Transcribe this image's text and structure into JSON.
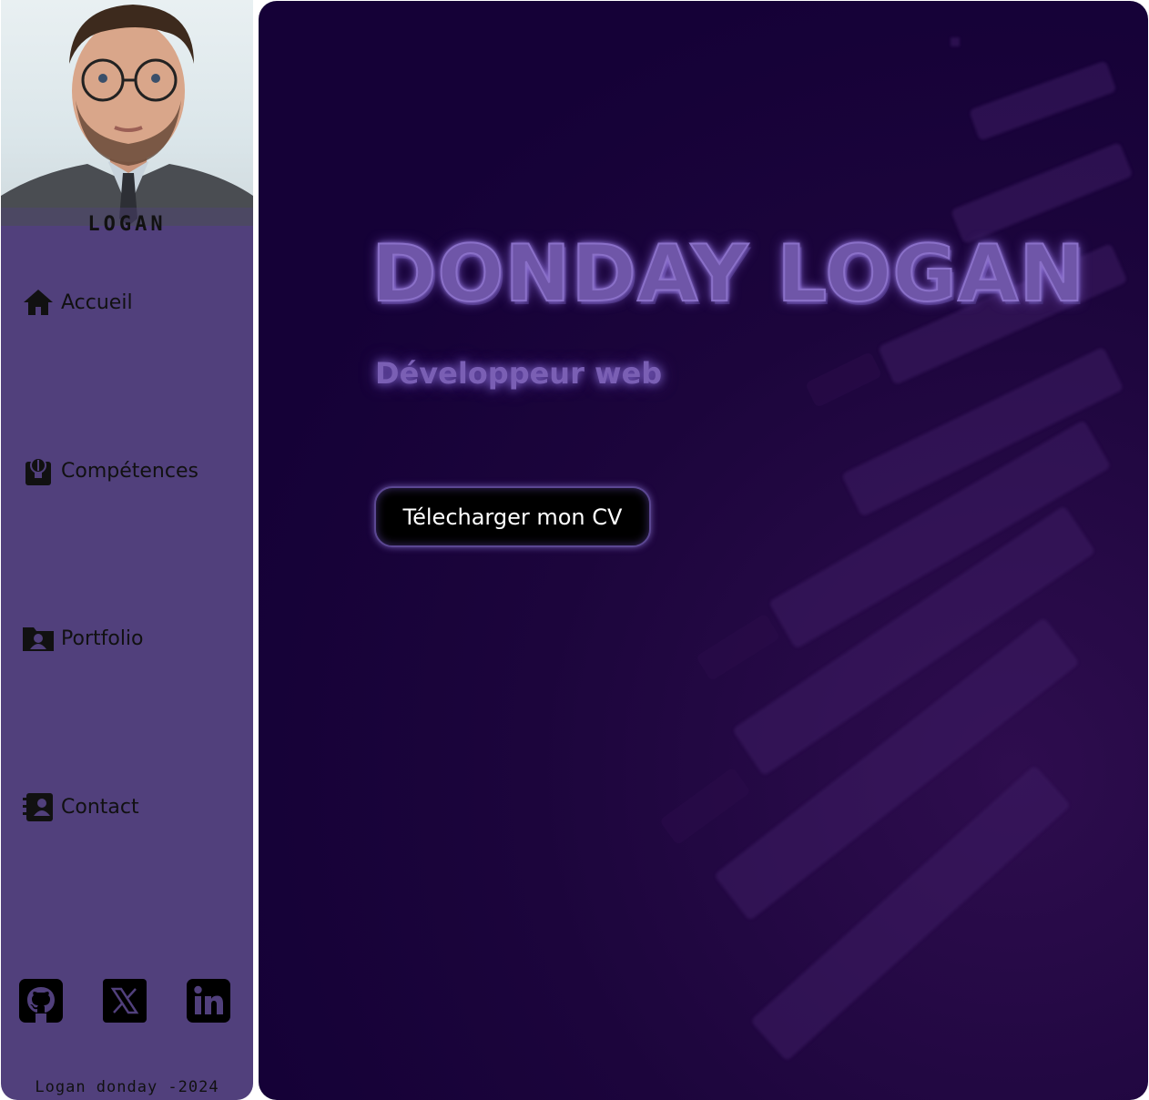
{
  "sidebar": {
    "brand_name": "LOGAN",
    "avatar_alt": "portrait",
    "nav": [
      {
        "label": "Accueil",
        "icon": "home-icon"
      },
      {
        "label": "Compétences",
        "icon": "skills-icon"
      },
      {
        "label": "Portfolio",
        "icon": "portfolio-icon"
      },
      {
        "label": "Contact",
        "icon": "contact-icon"
      }
    ],
    "socials": [
      {
        "name": "GitHub",
        "icon": "github-icon"
      },
      {
        "name": "X",
        "icon": "x-icon"
      },
      {
        "name": "LinkedIn",
        "icon": "linkedin-icon"
      }
    ],
    "footer": "Logan donday -2024"
  },
  "hero": {
    "title": "DONDAY LOGAN",
    "subtitle": "Développeur web",
    "cv_button": "Télecharger mon CV"
  },
  "colors": {
    "sidebar_bg": "#51407c",
    "main_bg": "#150137",
    "title": "#6f56a8",
    "button_bg": "#000000"
  }
}
